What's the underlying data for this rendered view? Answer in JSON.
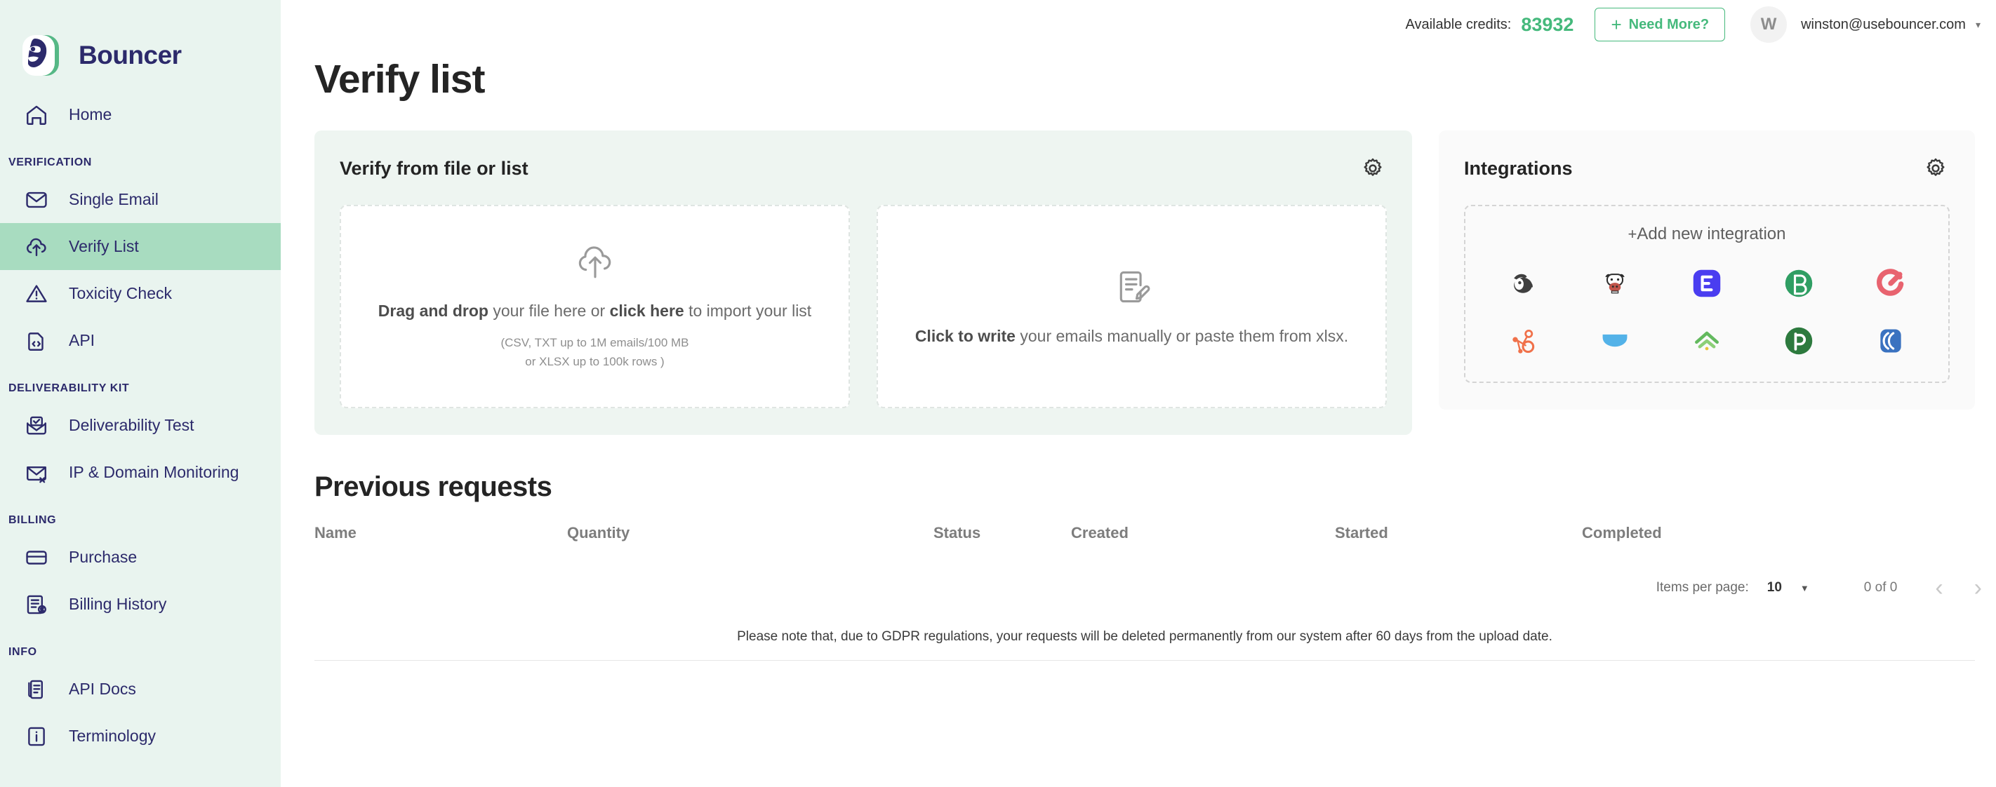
{
  "brand": {
    "name": "Bouncer",
    "logo_icon": "bouncer-gorilla-logo",
    "navy": "#2c2a6b",
    "green": "#45b97c"
  },
  "topbar": {
    "credits_label": "Available credits:",
    "credits_value": "83932",
    "need_more_label": "Need More?",
    "need_more_plus": "+",
    "avatar_initial": "W",
    "user_email": "winston@usebouncer.com",
    "caret": "▾"
  },
  "sidebar": {
    "home": {
      "label": "Home",
      "icon": "home-icon"
    },
    "sections": [
      {
        "label": "VERIFICATION",
        "items": [
          {
            "label": "Single Email",
            "icon": "envelope-icon",
            "active": false
          },
          {
            "label": "Verify List",
            "icon": "cloud-upload-icon",
            "active": true
          },
          {
            "label": "Toxicity Check",
            "icon": "warning-triangle-icon",
            "active": false
          },
          {
            "label": "API",
            "icon": "code-document-icon",
            "active": false
          }
        ]
      },
      {
        "label": "DELIVERABILITY KIT",
        "items": [
          {
            "label": "Deliverability Test",
            "icon": "envelope-check-icon",
            "active": false
          },
          {
            "label": "IP & Domain Monitoring",
            "icon": "envelope-x-icon",
            "active": false
          }
        ]
      },
      {
        "label": "BILLING",
        "items": [
          {
            "label": "Purchase",
            "icon": "credit-card-icon",
            "active": false
          },
          {
            "label": "Billing History",
            "icon": "invoice-dollar-icon",
            "active": false
          }
        ]
      },
      {
        "label": "INFO",
        "items": [
          {
            "label": "API Docs",
            "icon": "documents-stack-icon",
            "active": false
          },
          {
            "label": "Terminology",
            "icon": "info-box-icon",
            "active": false
          }
        ]
      }
    ]
  },
  "page": {
    "title": "Verify list"
  },
  "verify_card": {
    "title": "Verify from file or list",
    "settings_icon": "gear-icon",
    "dropzone_file": {
      "icon": "cloud-upload-icon",
      "bold_1": "Drag and drop",
      "text_1": " your file here or ",
      "bold_2": "click here",
      "text_2": " to import your list",
      "sub_line_1": "(CSV, TXT up to 1M emails/100 MB",
      "sub_line_2": "or XLSX up to 100k rows )"
    },
    "dropzone_manual": {
      "icon": "document-pencil-icon",
      "bold_1": "Click to write",
      "text_1": " your emails manually or paste them from xlsx."
    }
  },
  "integrations": {
    "title": "Integrations",
    "settings_icon": "gear-icon",
    "add_label": "Add new integration",
    "add_plus": "+",
    "logos": [
      {
        "name": "mailchimp-icon",
        "color": "#3f3f3f"
      },
      {
        "name": "moosend-icon",
        "color": "#2d2d2d"
      },
      {
        "name": "leadsbridge-icon",
        "color": "#4a3df0"
      },
      {
        "name": "brevo-icon",
        "color": "#2f9e63"
      },
      {
        "name": "convertkit-icon",
        "color": "#e8636f"
      },
      {
        "name": "hubspot-icon",
        "color": "#f0714a"
      },
      {
        "name": "mailjet-icon",
        "color": "#53b2e8"
      },
      {
        "name": "freshmail-icon",
        "color": "#63b95e"
      },
      {
        "name": "pipedrive-icon",
        "color": "#2d7a3e"
      },
      {
        "name": "keap-icon",
        "color": "#3a72c0"
      }
    ]
  },
  "previous_requests": {
    "title": "Previous requests",
    "columns": [
      "Name",
      "Quantity",
      "Status",
      "Created",
      "Started",
      "Completed"
    ],
    "rows": []
  },
  "pagination": {
    "items_per_page_label": "Items per page:",
    "items_per_page_value": "10",
    "caret": "▼",
    "range_label": "0 of 0",
    "prev_icon": "chevron-left-icon",
    "next_icon": "chevron-right-icon",
    "prev_glyph": "‹",
    "next_glyph": "›"
  },
  "gdpr_note": "Please note that, due to GDPR regulations, your requests will be deleted permanently from our system after 60 days from the upload date."
}
